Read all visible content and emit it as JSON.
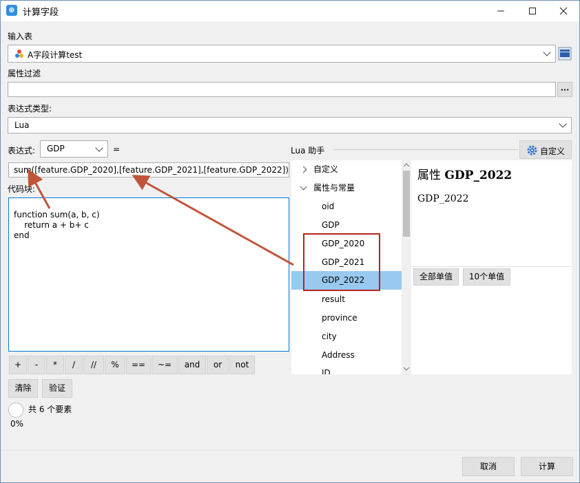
{
  "window": {
    "title": "计算字段"
  },
  "input_table": {
    "label": "输入表",
    "value": "A字段计算test"
  },
  "filter": {
    "label": "属性过滤",
    "value": "",
    "more_label": "···"
  },
  "expr_type": {
    "label": "表达式类型:",
    "value": "Lua"
  },
  "expression": {
    "label": "表达式:",
    "target_field": "GDP",
    "equals": "=",
    "value": "sum([feature.GDP_2020],[feature.GDP_2021],[feature.GDP_2022])"
  },
  "code_block": {
    "label": "代码块:",
    "lines": [
      "function sum(a, b, c)",
      "    return a + b+ c",
      "end"
    ]
  },
  "operators": [
    "+",
    "-",
    "*",
    "/",
    "//",
    "%",
    "==",
    "~=",
    "and",
    "or",
    "not"
  ],
  "actions": {
    "clear": "清除",
    "validate": "验证"
  },
  "status": {
    "feature_count": "共 6 个要素",
    "progress_text": "0%",
    "progress": 0
  },
  "lua_helper": {
    "title": "Lua 助手",
    "custom_button": "自定义",
    "tree": [
      {
        "label": "自定义",
        "kind": "group",
        "expanded": false
      },
      {
        "label": "属性与常量",
        "kind": "group",
        "expanded": true
      },
      {
        "label": "oid",
        "kind": "field"
      },
      {
        "label": "GDP",
        "kind": "field"
      },
      {
        "label": "GDP_2020",
        "kind": "field"
      },
      {
        "label": "GDP_2021",
        "kind": "field"
      },
      {
        "label": "GDP_2022",
        "kind": "field",
        "selected": true
      },
      {
        "label": "result",
        "kind": "field"
      },
      {
        "label": "province",
        "kind": "field"
      },
      {
        "label": "city",
        "kind": "field"
      },
      {
        "label": "Address",
        "kind": "field"
      },
      {
        "label": "ID",
        "kind": "field"
      }
    ],
    "detail": {
      "heading_prefix": "属性",
      "heading_name": "GDP_2022",
      "name": "GDP_2022"
    },
    "all_values_button": "全部单值",
    "ten_values_button": "10个单值"
  },
  "footer": {
    "cancel": "取消",
    "compute": "计算"
  },
  "colors": {
    "accent": "#0078d7",
    "selection": "#99c9ef",
    "highlight_box": "#b22222",
    "arrow": "#c0553a"
  }
}
